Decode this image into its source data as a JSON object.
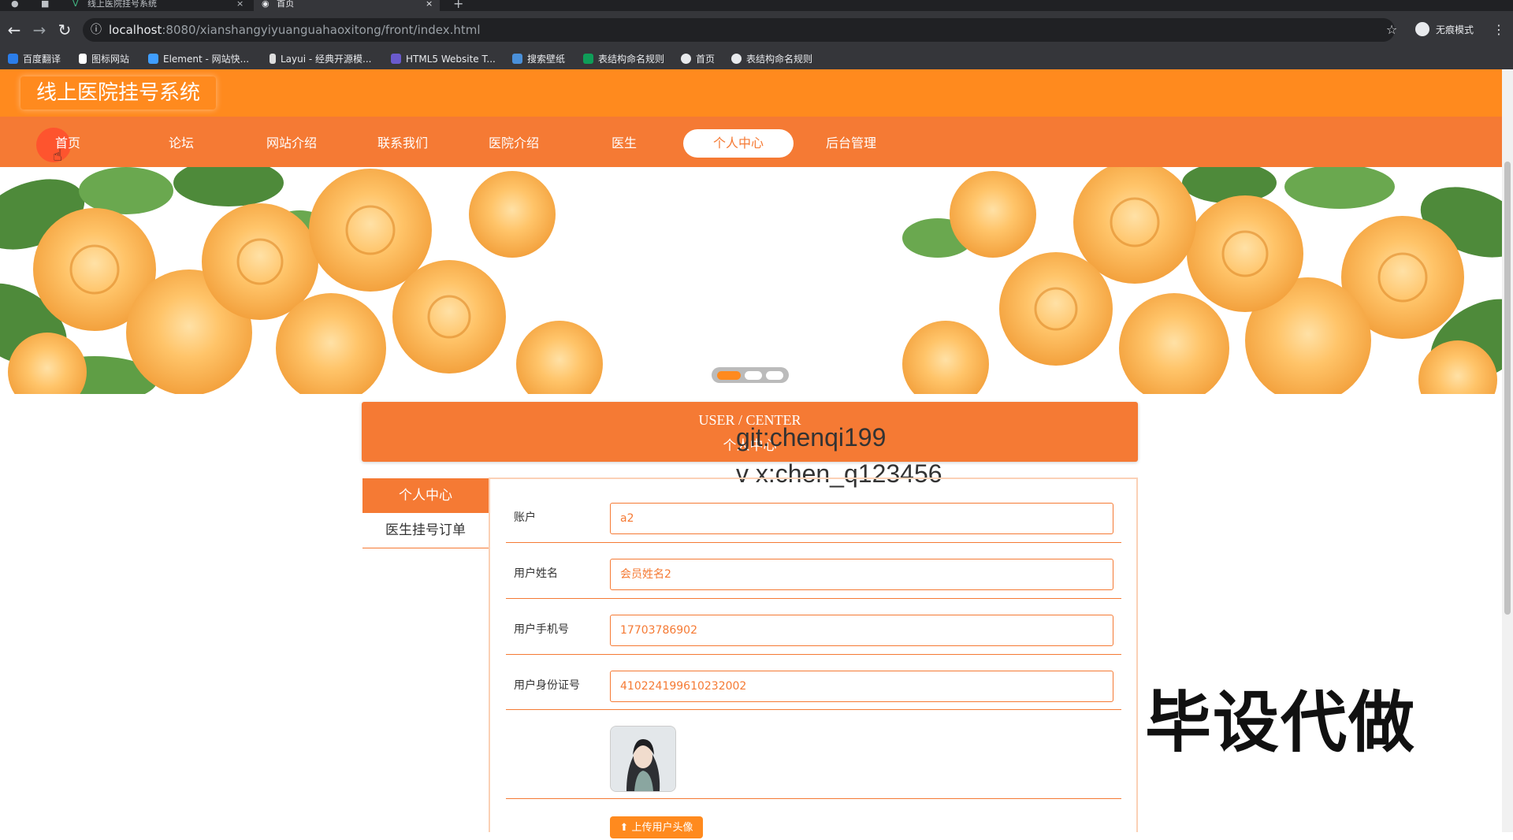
{
  "browser": {
    "tabs": [
      {
        "label": "线上医院挂号系统"
      },
      {
        "label": "首页"
      }
    ],
    "new_tab": "+",
    "close": "×",
    "url_host": "localhost",
    "url_rest": ":8080/xianshangyiyuanguahaoxitong/front/index.html",
    "profile_label": "无痕模式",
    "bookmarks": [
      {
        "label": "百度翻译",
        "icon": "translate-icon",
        "color": "#2b7de9"
      },
      {
        "label": "图标网站",
        "icon": "flag-icon",
        "color": "#ffffff"
      },
      {
        "label": "Element - 网站快...",
        "icon": "element-icon",
        "color": "#409eff"
      },
      {
        "label": "Layui - 经典开源模...",
        "icon": "layui-icon",
        "color": "#dddddd"
      },
      {
        "label": "HTML5 Website T...",
        "icon": "html5-icon",
        "color": "#6a5acd"
      },
      {
        "label": "搜索壁纸",
        "icon": "wallpaper-icon",
        "color": "#4a90d9"
      },
      {
        "label": "表结构命名规则",
        "icon": "sheet-icon",
        "color": "#0f9d58"
      },
      {
        "label": "首页",
        "icon": "globe-icon",
        "color": "#e8eaed"
      },
      {
        "label": "表结构命名规则",
        "icon": "globe-icon",
        "color": "#e8eaed"
      }
    ]
  },
  "site": {
    "brand": "线上医院挂号系统",
    "accent": "#f57a34",
    "header_color": "#ff8a1e",
    "nav": [
      {
        "label": "首页",
        "active": false
      },
      {
        "label": "论坛",
        "active": false
      },
      {
        "label": "网站介绍",
        "active": false
      },
      {
        "label": "联系我们",
        "active": false
      },
      {
        "label": "医院介绍",
        "active": false
      },
      {
        "label": "医生",
        "active": false
      },
      {
        "label": "个人中心",
        "active": true
      },
      {
        "label": "后台管理",
        "active": false
      }
    ]
  },
  "user_center": {
    "title_en": "USER / CENTER",
    "title_cn": "个人中心",
    "side_menu": [
      "个人中心",
      "医生挂号订单"
    ],
    "fields": [
      {
        "label": "账户",
        "value": "a2"
      },
      {
        "label": "用户姓名",
        "value": "会员姓名2"
      },
      {
        "label": "用户手机号",
        "value": "17703786902"
      },
      {
        "label": "用户身份证号",
        "value": "410224199610232002"
      }
    ],
    "upload_label": "上传用户头像"
  },
  "watermarks": {
    "git": "git:chenqi199",
    "vx": "v x:chen_q123456",
    "big": "毕设代做"
  }
}
